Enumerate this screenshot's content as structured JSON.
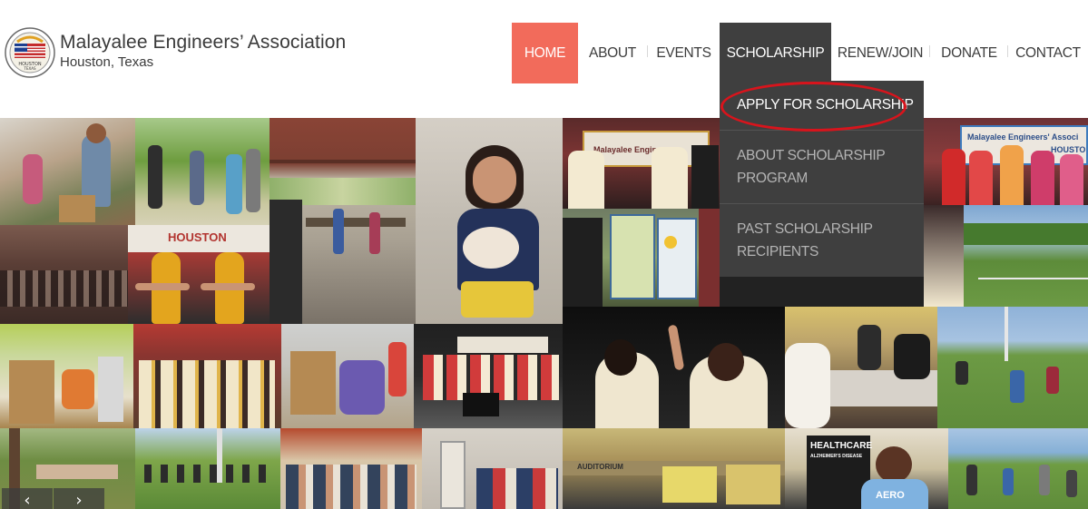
{
  "brand": {
    "title": "Malayalee Engineers’ Association",
    "subtitle": "Houston, Texas",
    "seal_text": "HOUSTON TEXAS"
  },
  "nav": {
    "items": [
      {
        "label": "HOME",
        "state": "active"
      },
      {
        "label": "ABOUT",
        "state": "normal"
      },
      {
        "label": "EVENTS",
        "state": "normal"
      },
      {
        "label": "SCHOLARSHIP",
        "state": "open"
      },
      {
        "label": "RENEW/JOIN",
        "state": "normal"
      },
      {
        "label": "DONATE",
        "state": "normal"
      },
      {
        "label": "CONTACT",
        "state": "normal"
      }
    ]
  },
  "dropdown": {
    "items": [
      {
        "line1": "APPLY FOR SCHOLARSHIP",
        "line2": ""
      },
      {
        "line1": "ABOUT SCHOLARSHIP",
        "line2": "PROGRAM"
      },
      {
        "line1": "PAST SCHOLARSHIP",
        "line2": "RECIPIENTS"
      }
    ]
  },
  "collage": {
    "banner_houston": "HOUSTON",
    "banner_mea": "Malayalee Engineers",
    "banner_mea_right": "Malayalee Engineers' Associ",
    "banner_houston_right": "HOUSTO",
    "poster_healthcare": "HEALTHCARE",
    "poster_alzheimer": "ALZHEIMER'S DISEASE",
    "shirt_text": "AERO",
    "auditorium": "AUDITORIUM"
  },
  "slider": {
    "prev": "‹",
    "next": "›"
  },
  "colors": {
    "accent": "#f26b5b",
    "nav_dark": "#3f3f3f",
    "highlight_ring": "#d8141c"
  }
}
